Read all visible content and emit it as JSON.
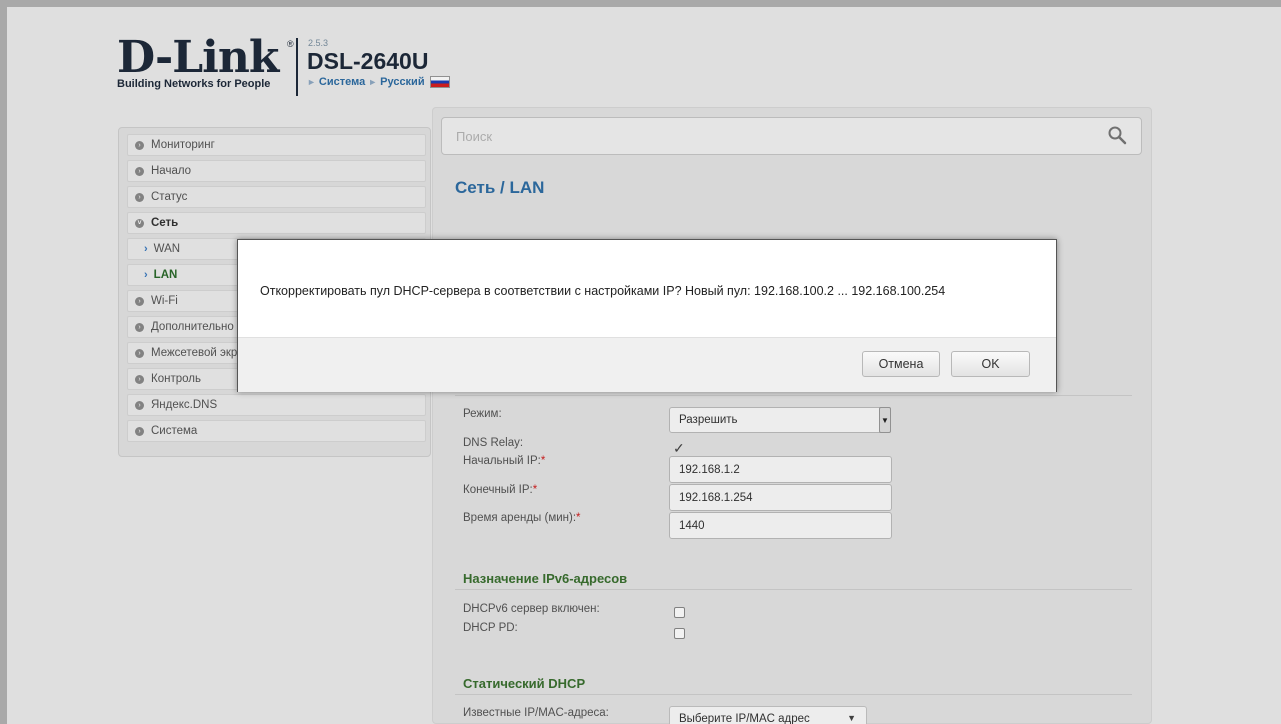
{
  "header": {
    "logo_word": "D-Link",
    "logo_registered": "®",
    "logo_tagline": "Building Networks for People",
    "firmware_version": "2.5.3",
    "model": "DSL-2640U",
    "crumb_system": "Система",
    "crumb_language": "Русский"
  },
  "sidebar": {
    "items": [
      {
        "label": "Мониторинг"
      },
      {
        "label": "Начало"
      },
      {
        "label": "Статус"
      },
      {
        "label": "Сеть"
      },
      {
        "label": "WAN"
      },
      {
        "label": "LAN"
      },
      {
        "label": "Wi-Fi"
      },
      {
        "label": "Дополнительно"
      },
      {
        "label": "Межсетевой экран"
      },
      {
        "label": "Контроль"
      },
      {
        "label": "Яндекс.DNS"
      },
      {
        "label": "Система"
      }
    ]
  },
  "search": {
    "placeholder": "Поиск"
  },
  "main": {
    "title": "Сеть /  LAN",
    "dhcp": {
      "mode_label": "Режим:",
      "mode_value": "Разрешить",
      "dns_relay_label": "DNS Relay:",
      "start_ip_label": "Начальный IP:",
      "start_ip_value": "192.168.1.2",
      "end_ip_label": "Конечный IP:",
      "end_ip_value": "192.168.1.254",
      "lease_label": "Время аренды (мин):",
      "lease_value": "1440",
      "required_mark": "*"
    },
    "ipv6": {
      "section_title": "Назначение IPv6-адресов",
      "dhcpv6_label": "DHCPv6 сервер включен:",
      "dhcp_pd_label": "DHCP PD:"
    },
    "static_dhcp": {
      "section_title": "Статический DHCP",
      "known_label": "Известные IP/MAC-адреса:",
      "known_select_value": "Выберите IP/MAC адрес"
    }
  },
  "dialog": {
    "message": "Откорректировать пул DHCP-сервера в соответствии с настройками IP? Новый пул: 192.168.100.2 ... 192.168.100.254",
    "cancel_label": "Отмена",
    "ok_label": "OK"
  }
}
